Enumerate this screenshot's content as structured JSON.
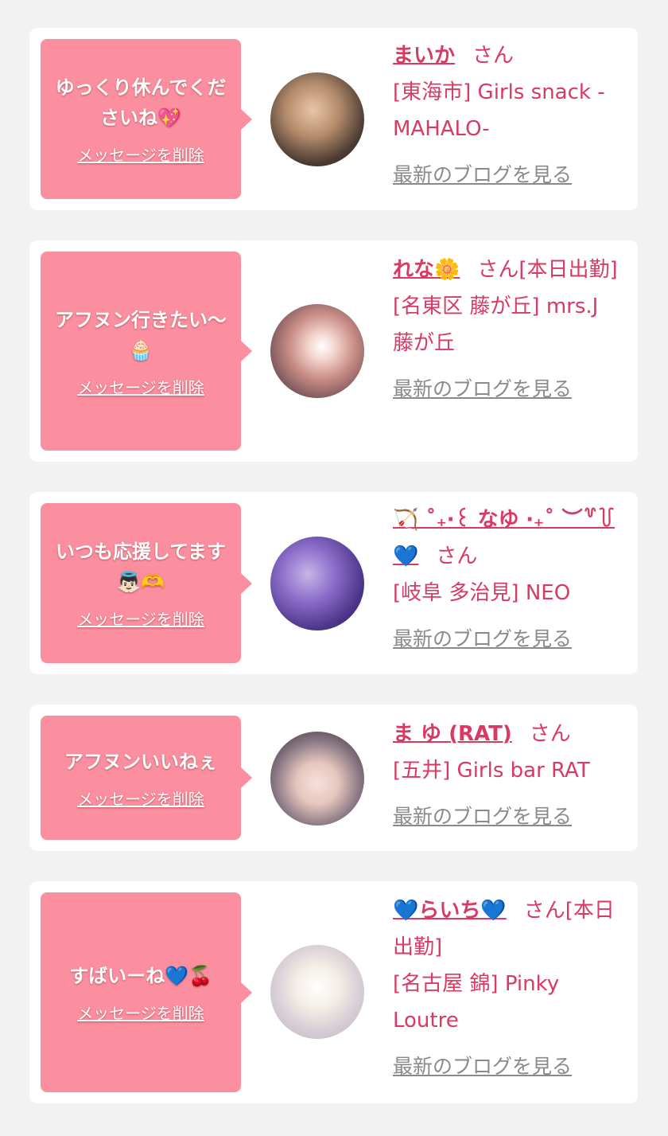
{
  "messages": [
    {
      "bubble_text": "ゆっくり休んでくださいね💖",
      "delete_label": "メッセージを削除",
      "name": "まいか",
      "san": "さん",
      "shop": "[東海市] Girls snack -MAHALO-",
      "blog_label": "最新のブログを見る"
    },
    {
      "bubble_text": "アフヌン行きたい〜🧁",
      "delete_label": "メッセージを削除",
      "name": "れな🌼",
      "san": "さん[本日出勤]",
      "shop": "[名東区 藤が丘] mrs.J 藤が丘",
      "blog_label": "最新のブログを見る"
    },
    {
      "bubble_text": "いつも応援してます👼🏻🫶",
      "delete_label": "メッセージを削除",
      "name": "🏹 ˚₊‧꒰ なゆ ‧₊˚ ︶꒷꒦ 💙",
      "san": "さん",
      "shop": "[岐阜 多治見] NEO",
      "blog_label": "最新のブログを見る"
    },
    {
      "bubble_text": "アフヌンいいねぇ",
      "delete_label": "メッセージを削除",
      "name": "ま ゆ (RAT)",
      "san": "さん",
      "shop": "[五井] Girls bar RAT",
      "blog_label": "最新のブログを見る"
    },
    {
      "bubble_text": "すばいーね💙🍒",
      "delete_label": "メッセージを削除",
      "name": "💙らいち💙",
      "san": "さん[本日出勤]",
      "shop": "[名古屋 錦] Pinky Loutre",
      "blog_label": "最新のブログを見る"
    }
  ]
}
